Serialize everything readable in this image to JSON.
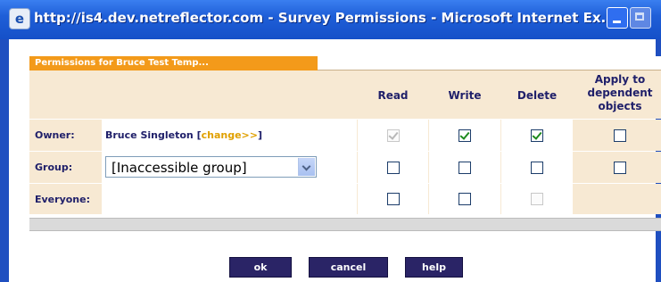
{
  "window": {
    "title": "http://is4.dev.netreflector.com - Survey Permissions - Microsoft Internet Ex...",
    "icon": "ie-page-icon"
  },
  "panel": {
    "tab_label": "Permissions for  Bruce Test Temp..."
  },
  "columns": {
    "read": "Read",
    "write": "Write",
    "delete": "Delete",
    "apply_line1": "Apply to",
    "apply_line2": "dependent",
    "apply_line3": "objects"
  },
  "rows": {
    "owner": {
      "label": "Owner:",
      "name": "Bruce Singleton",
      "link_open": " [",
      "link": "change>>",
      "link_close": "]",
      "read": {
        "checked": true,
        "disabled": true
      },
      "write": {
        "checked": true,
        "disabled": false
      },
      "delete": {
        "checked": true,
        "disabled": false
      },
      "apply": {
        "checked": false,
        "disabled": false
      }
    },
    "group": {
      "label": "Group:",
      "select_value": "[Inaccessible group]",
      "read": {
        "checked": false,
        "disabled": false
      },
      "write": {
        "checked": false,
        "disabled": false
      },
      "delete": {
        "checked": false,
        "disabled": false
      },
      "apply": {
        "checked": false,
        "disabled": false
      }
    },
    "everyone": {
      "label": "Everyone:",
      "read": {
        "checked": false,
        "disabled": false
      },
      "write": {
        "checked": false,
        "disabled": false
      },
      "delete": {
        "checked": false,
        "disabled": true
      }
    }
  },
  "buttons": {
    "ok": "ok",
    "cancel": "cancel",
    "help": "help"
  },
  "colors": {
    "accent_tab": "#f39a1a",
    "row_bg": "#f7e9d3",
    "button_bg": "#2a2466",
    "text": "#20206a"
  }
}
